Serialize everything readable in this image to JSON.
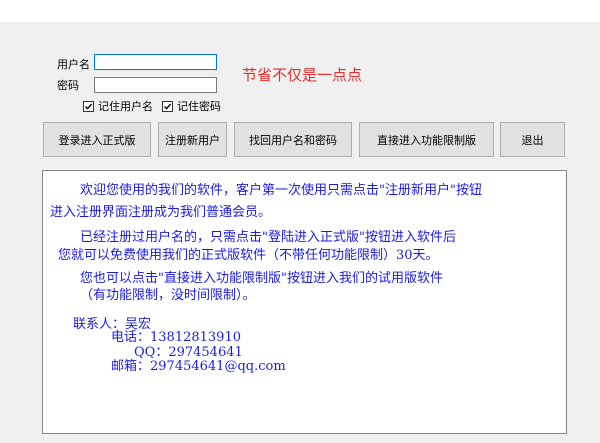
{
  "form": {
    "username_label": "用户名",
    "username_value": "",
    "password_label": "密码",
    "password_value": "",
    "remember_user_label": "记住用户名",
    "remember_user_checked": true,
    "remember_pass_label": "记住密码",
    "remember_pass_checked": true
  },
  "slogan": "节省不仅是一点点",
  "buttons": {
    "login": "登录进入正式版",
    "register": "注册新用户",
    "recover": "找回用户名和密码",
    "limited": "直接进入功能限制版",
    "exit": "退出"
  },
  "info": {
    "p1_line1": "欢迎您使用的我们的软件，客户第一次使用只需点击\"注册新用户\"按钮",
    "p1_line2": "进入注册界面注册成为我们普通会员。",
    "p2_line1": "已经注册过用户名的，只需点击\"登陆进入正式版\"按钮进入软件后",
    "p2_line2": "您就可以免费使用我们的正式版软件（不带任何功能限制）30天。",
    "p3_line1": "您也可以点击\"直接进入功能限制版\"按钮进入我们的试用版软件",
    "p3_line2": "（有功能限制，没时间限制）。",
    "contact_line": "联系人：吴宏",
    "phone_line": "电话：13812813910",
    "qq_line": "QQ：297454641",
    "email_line": "邮箱：297454641@qq.com"
  },
  "colors": {
    "slogan": "#e03030",
    "info_text": "#1c1cdc",
    "focus_border": "#0078d7"
  }
}
